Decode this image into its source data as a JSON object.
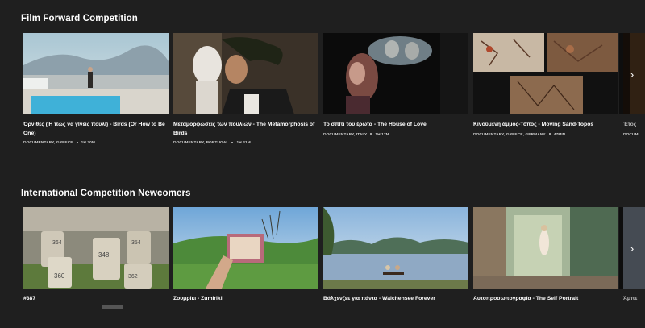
{
  "sections": [
    {
      "title": "Film Forward Competition",
      "cards": [
        {
          "title": "Όρνιθες (Ή πώς να γίνεις πουλί) - Birds (Or How to Be One)",
          "genre": "DOCUMENTARY, GREECE",
          "duration": "1H 20M"
        },
        {
          "title": "Μεταμορφώσεις των πουλιών - The Metamorphosis of Birds",
          "genre": "DOCUMENTARY, PORTUGAL",
          "duration": "1H 41M"
        },
        {
          "title": "Το σπίτι του έρωτα - The House of Love",
          "genre": "DOCUMENTARY, ITALY",
          "duration": "1H 17M"
        },
        {
          "title": "Κινούμενη άμμος-Τόπος - Moving Sand-Topos",
          "genre": "DOCUMENTARY, GREECE, GERMANY",
          "duration": "47MIN"
        },
        {
          "title": "Έτος",
          "genre": "DOCUM",
          "duration": ""
        }
      ]
    },
    {
      "title": "International Competition Newcomers",
      "cards": [
        {
          "title": "#387",
          "genre": "",
          "duration": ""
        },
        {
          "title": "Σουμρίκι - Zumiriki",
          "genre": "",
          "duration": ""
        },
        {
          "title": "Βάλχενζεε για πάντα - Walchensee Forever",
          "genre": "",
          "duration": ""
        },
        {
          "title": "Αυτοπροσωπογραφία - The Self Portrait",
          "genre": "",
          "duration": ""
        },
        {
          "title": "Άμπε",
          "genre": "",
          "duration": ""
        }
      ]
    }
  ],
  "grave_numbers": [
    "364",
    "348",
    "360",
    "354",
    "362"
  ],
  "nav": {
    "next_icon": "›"
  }
}
